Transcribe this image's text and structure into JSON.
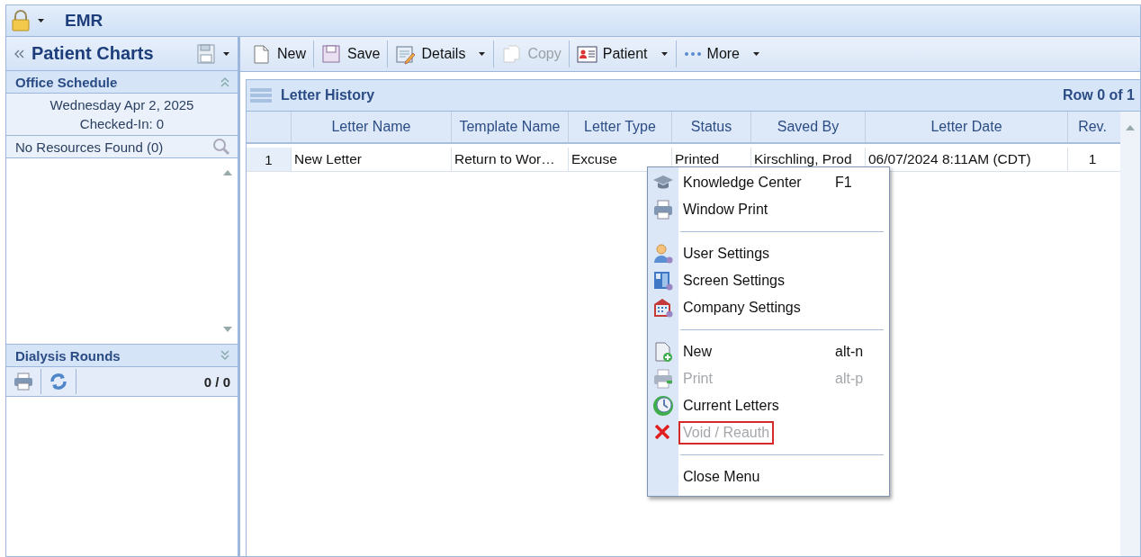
{
  "app": {
    "title": "EMR"
  },
  "sidebar": {
    "title": "Patient Charts",
    "office_schedule": {
      "title": "Office Schedule",
      "date": "Wednesday Apr 2, 2025",
      "checked_in": "Checked-In: 0",
      "resources": "No Resources Found (0)",
      "expanded": true
    },
    "dialysis": {
      "title": "Dialysis Rounds",
      "count": "0 / 0",
      "expanded": false
    }
  },
  "toolbar": [
    {
      "label": "New",
      "dropdown": false,
      "disabled": false
    },
    {
      "label": "Save",
      "dropdown": false,
      "disabled": false
    },
    {
      "label": "Details",
      "dropdown": true,
      "disabled": false
    },
    {
      "label": "Copy",
      "dropdown": false,
      "disabled": true
    },
    {
      "label": "Patient",
      "dropdown": true,
      "disabled": false
    },
    {
      "label": "More",
      "dropdown": true,
      "disabled": false
    }
  ],
  "letter_history": {
    "title": "Letter History",
    "row_status": "Row 0 of 1",
    "columns": [
      "Letter Name",
      "Template Name",
      "Letter Type",
      "Status",
      "Saved By",
      "Letter Date",
      "Rev."
    ],
    "rows": [
      {
        "number": "1",
        "cells": [
          "New Letter",
          "Return to Wor…",
          "Excuse",
          "Printed",
          "Kirschling, Prod",
          "06/07/2024  8:11AM (CDT)",
          "1"
        ]
      }
    ]
  },
  "context_menu": {
    "items": [
      {
        "kind": "item",
        "label": "Knowledge Center",
        "shortcut": "F1",
        "disabled": false,
        "outlined": false
      },
      {
        "kind": "item",
        "label": "Window Print",
        "disabled": false,
        "outlined": false
      },
      {
        "kind": "separator"
      },
      {
        "kind": "item",
        "label": "User Settings",
        "disabled": false,
        "outlined": false
      },
      {
        "kind": "item",
        "label": "Screen Settings",
        "disabled": false,
        "outlined": false
      },
      {
        "kind": "item",
        "label": "Company Settings",
        "disabled": false,
        "outlined": false
      },
      {
        "kind": "separator"
      },
      {
        "kind": "item",
        "label": "New",
        "shortcut": "alt-n",
        "disabled": false,
        "outlined": false
      },
      {
        "kind": "item",
        "label": "Print",
        "shortcut": "alt-p",
        "disabled": true,
        "outlined": false
      },
      {
        "kind": "item",
        "label": "Current Letters",
        "disabled": false,
        "outlined": false
      },
      {
        "kind": "item",
        "label": "Void / Reauth",
        "disabled": true,
        "outlined": true
      },
      {
        "kind": "separator"
      },
      {
        "kind": "item",
        "label": "Close Menu",
        "disabled": false,
        "outlined": false
      }
    ]
  }
}
